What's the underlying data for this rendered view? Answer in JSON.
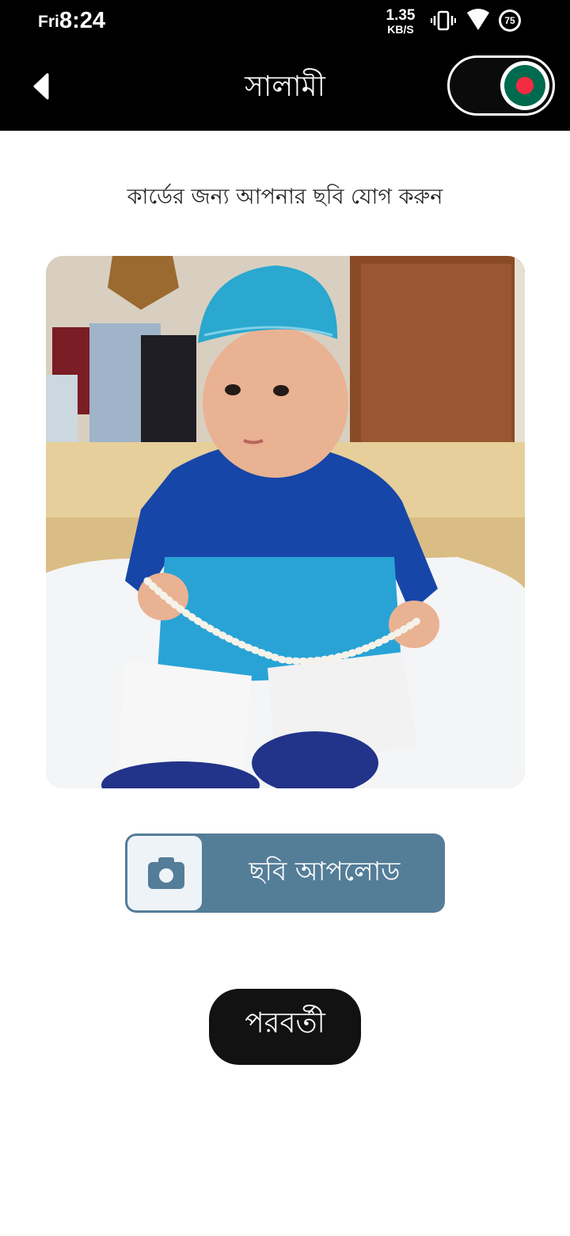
{
  "status_bar": {
    "day": "Fri",
    "time": "8:24",
    "net_speed_value": "1.35",
    "net_speed_unit": "KB/S",
    "battery": "75",
    "icons": [
      "vibrate-icon",
      "wifi-icon",
      "battery-icon"
    ]
  },
  "app_bar": {
    "title": "সালামী",
    "back_icon": "back-arrow-icon",
    "flag_colors": {
      "green": "#006a4e",
      "red": "#f42a41"
    }
  },
  "main": {
    "instruction": "কার্ডের জন্য আপনার ছবি যোগ করুন",
    "photo": {
      "subject": "baby-photo"
    },
    "upload_button": {
      "label": "ছবি আপলোড",
      "icon": "camera-icon",
      "color": "#547d98"
    },
    "next_button": {
      "label": "পরবর্তী"
    }
  }
}
